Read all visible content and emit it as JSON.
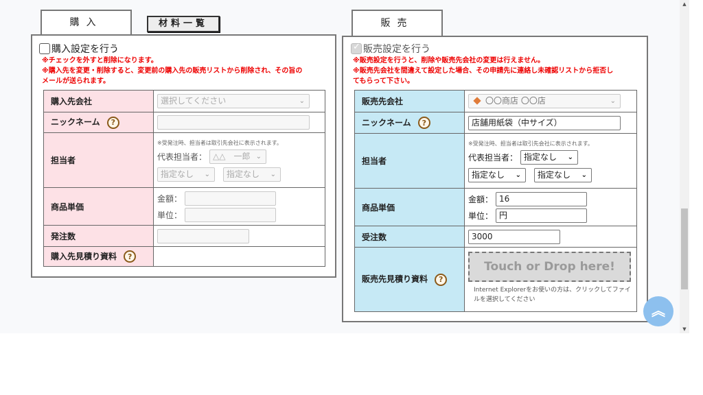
{
  "tabs": {
    "purchase": "購入",
    "materials_list": "材料一覧",
    "sales": "販売"
  },
  "purchase": {
    "checkbox_label": "購入設定を行う",
    "notes": [
      "※チェックを外すと削除になります。",
      "※購入先を変更・削除すると、変更前の購入先の販売リストから削除され、その旨の",
      "メールが送られます。"
    ],
    "labels": {
      "company": "購入先会社",
      "nickname": "ニックネーム",
      "contact": "担当者",
      "unit_price": "商品単価",
      "order_qty": "発注数",
      "estimate": "購入先見積り資料"
    },
    "company_placeholder": "選択してください",
    "nickname_value": "",
    "contact_note": "※受発注時、担当者は取引先会社に表示されます。",
    "rep_label": "代表担当者：",
    "rep_value": "△△　一郎",
    "sub_contact_1": "指定なし",
    "sub_contact_2": "指定なし",
    "amount_label": "金額：",
    "amount_value": "",
    "unit_label": "単位：",
    "unit_value": "",
    "order_qty_value": ""
  },
  "sales": {
    "checkbox_label": "販売設定を行う",
    "notes": [
      "※販売設定を行うと、削除や販売先会社の変更は行えません。",
      "※販売先会社を間違えて設定した場合、その申請先に連絡し未確認リストから拒否し",
      "てもらって下さい。"
    ],
    "labels": {
      "company": "販売先会社",
      "nickname": "ニックネーム",
      "contact": "担当者",
      "unit_price": "商品単価",
      "order_qty": "受注数",
      "estimate": "販売先見積り資料"
    },
    "company_value": "〇〇商店 〇〇店",
    "nickname_value": "店舗用紙袋（中サイズ）",
    "contact_note": "※受発注時、担当者は取引先会社に表示されます。",
    "rep_label": "代表担当者：",
    "rep_value": "指定なし",
    "sub_contact_1": "指定なし",
    "sub_contact_2": "指定なし",
    "amount_label": "金額：",
    "amount_value": "16",
    "unit_label": "単位：",
    "unit_value": "円",
    "order_qty_value": "3000",
    "drop_text": "Touch or Drop here!",
    "drop_note": "Internet Explorerをお使いの方は、クリックしてファイルを選択してください"
  },
  "icons": {
    "help": "help-question-icon",
    "select_arrow": "chevron-down-icon",
    "scroll_top": "double-chevron-up-icon"
  },
  "colors": {
    "purchase_label_bg": "#fde1e6",
    "sales_label_bg": "#c6e9f5",
    "notice_red": "#e00000",
    "fab_blue": "#8dc0ee"
  }
}
